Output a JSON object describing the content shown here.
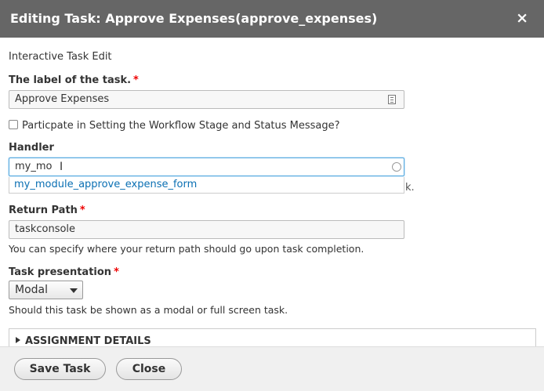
{
  "dialog": {
    "title": "Editing Task: Approve Expenses(approve_expenses)",
    "close_glyph": "×"
  },
  "form": {
    "intro": "Interactive Task Edit",
    "task_label": {
      "label": "The label of the task.",
      "required_mark": "*",
      "value": "Approve Expenses"
    },
    "workflow_checkbox": {
      "label": "Particpate in Setting the Workflow Stage and Status Message?",
      "checked": false
    },
    "handler": {
      "label": "Handler",
      "value": "my_mo",
      "autocomplete_suggestion": "my_module_approve_expense_form",
      "obscured_description_tail": "k."
    },
    "return_path": {
      "label": "Return Path",
      "required_mark": "*",
      "value": "taskconsole",
      "description": "You can specify where your return path should go upon task completion."
    },
    "task_presentation": {
      "label": "Task presentation",
      "required_mark": "*",
      "selected": "Modal",
      "description": "Should this task be shown as a modal or full screen task."
    },
    "assignment_details": {
      "summary": "ASSIGNMENT DETAILS"
    }
  },
  "footer": {
    "save_label": "Save Task",
    "close_label": "Close"
  }
}
